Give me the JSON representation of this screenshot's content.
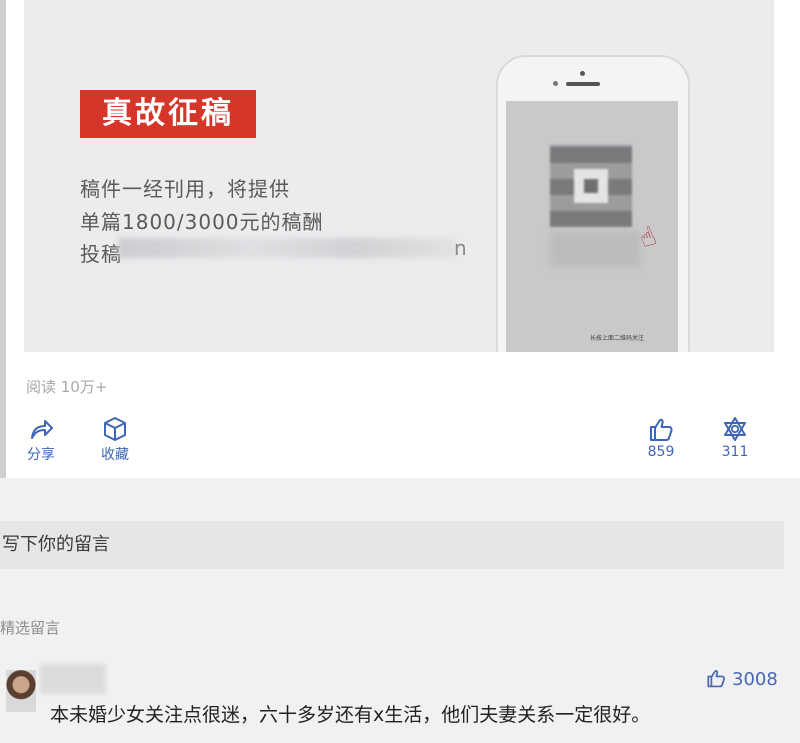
{
  "banner": {
    "tag": "真故征稿",
    "line1": "稿件一经刊用，将提供",
    "line2": "单篇1800/3000元的稿酬",
    "line3_prefix": "投稿",
    "line3_suffix": "n",
    "screen_caption": "长按上面二维码关注"
  },
  "stats": {
    "reads": "阅读 10万+"
  },
  "actions": {
    "share": "分享",
    "favorite": "收藏",
    "like_count": "859",
    "wow_count": "311"
  },
  "comment_input": {
    "placeholder": "写下你的留言"
  },
  "comments_section": {
    "title": "精选留言"
  },
  "comment": {
    "likes": "3008",
    "text": "本未婚少女关注点很迷，六十多岁还有x生活，他们夫妻关系一定很好。"
  },
  "colors": {
    "accent_blue": "#3e66b8",
    "tag_red": "#d6352a"
  },
  "icons": [
    "share-icon",
    "box-icon",
    "thumbs-up-icon",
    "star-of-david-icon",
    "hand-pointer-icon"
  ]
}
